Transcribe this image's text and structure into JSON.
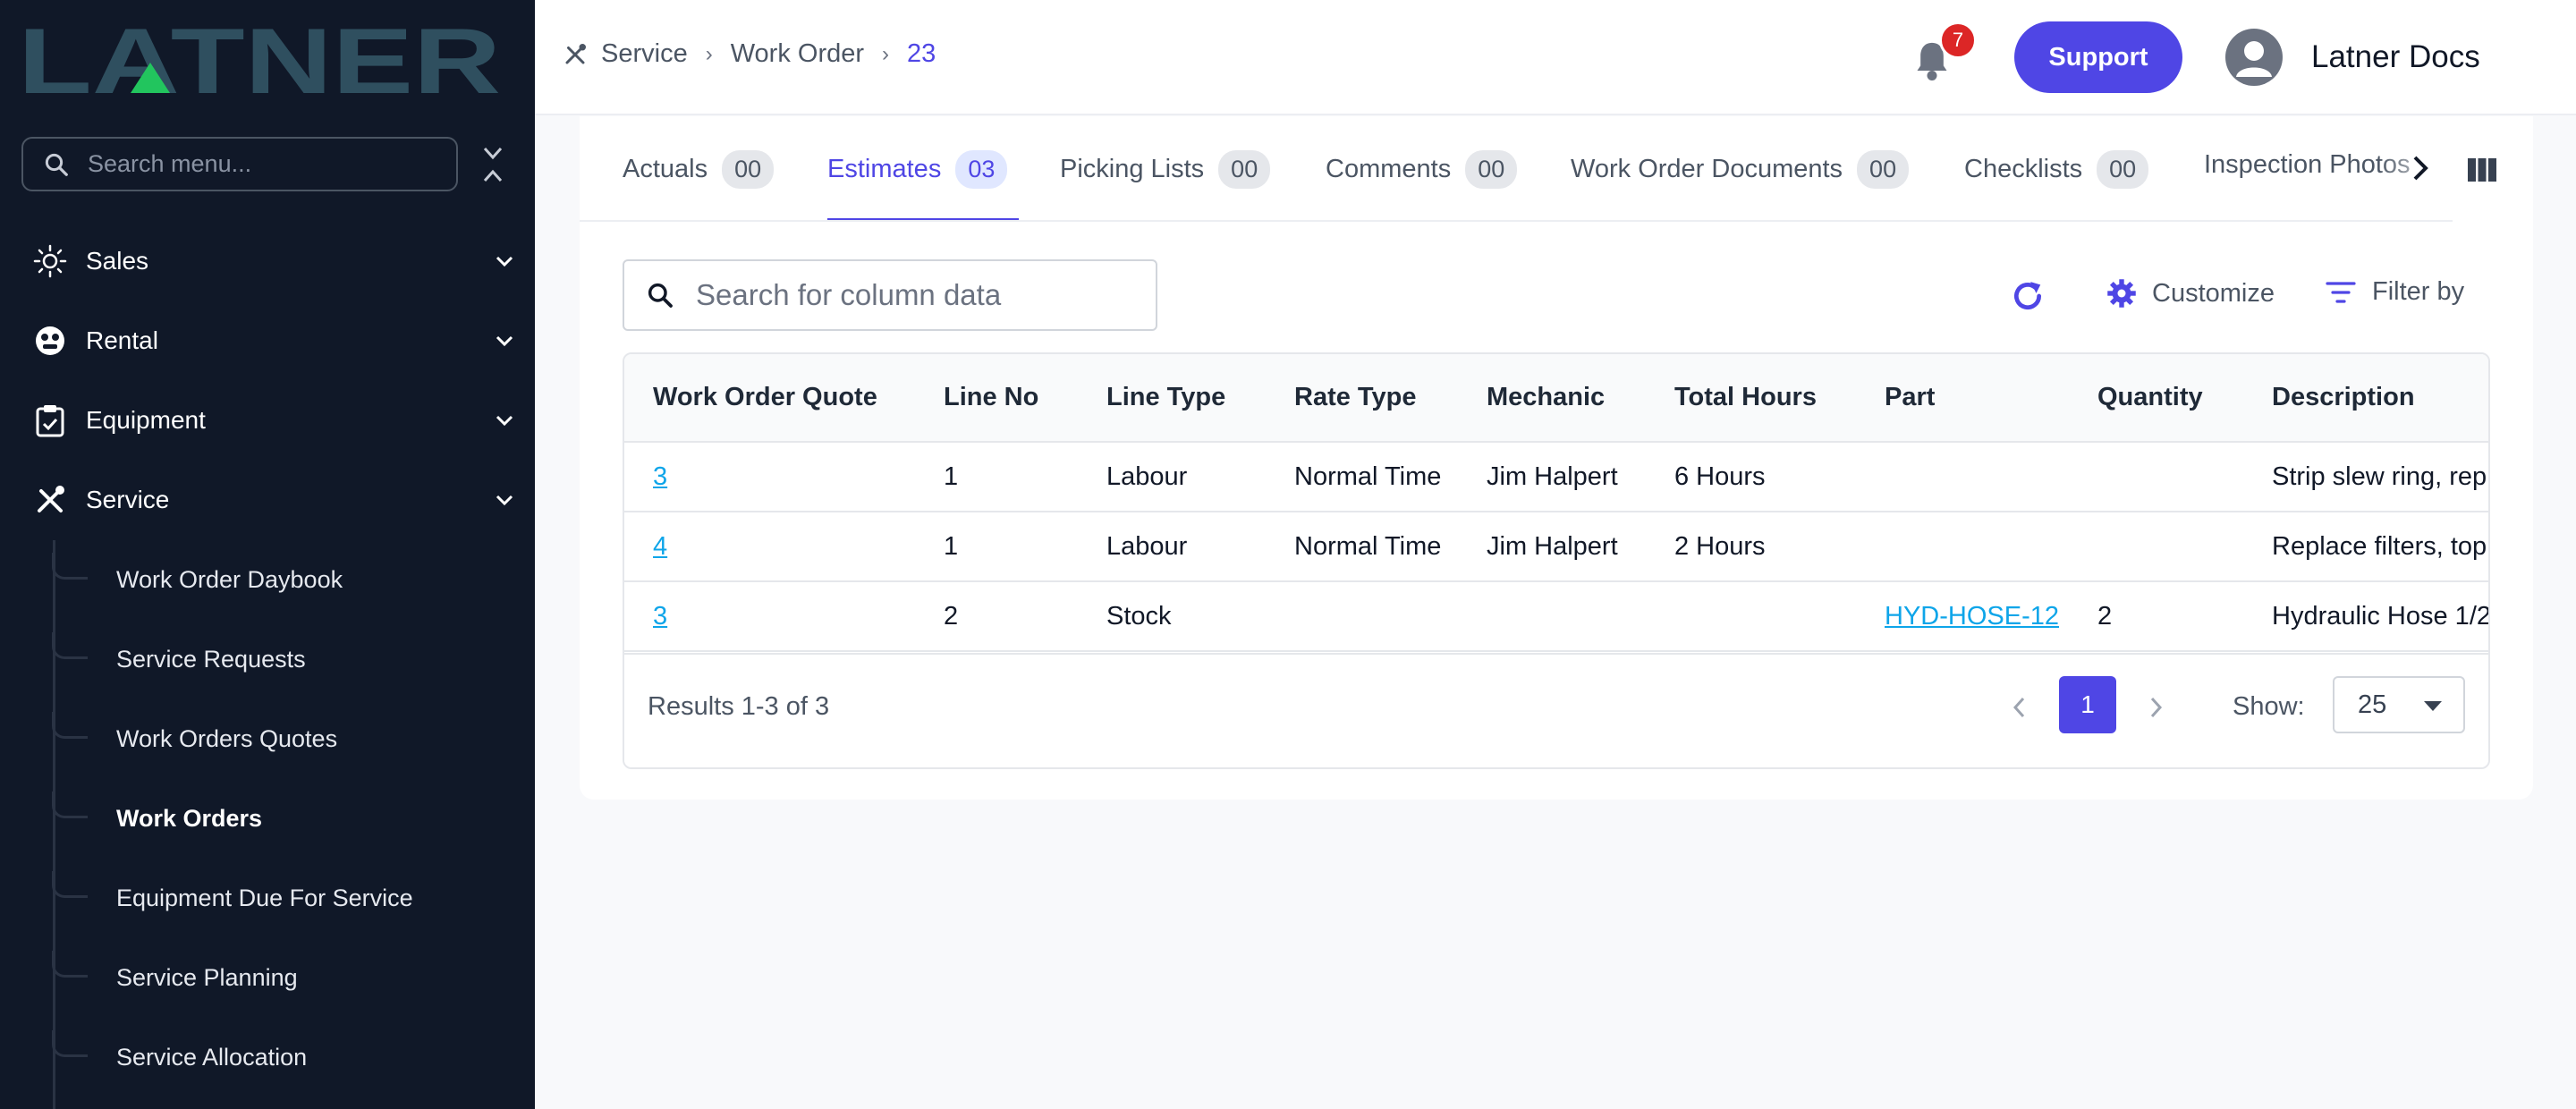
{
  "brand": {
    "logo_text": "LATNER"
  },
  "sidebar": {
    "search_placeholder": "Search menu...",
    "items": [
      {
        "label": "Sales",
        "icon": "sales-icon"
      },
      {
        "label": "Rental",
        "icon": "rental-icon"
      },
      {
        "label": "Equipment",
        "icon": "equipment-icon"
      },
      {
        "label": "Service",
        "icon": "service-tools-icon"
      }
    ],
    "service_subitems": [
      {
        "label": "Work Order Daybook"
      },
      {
        "label": "Service Requests"
      },
      {
        "label": "Work Orders Quotes"
      },
      {
        "label": "Work Orders",
        "active": true
      },
      {
        "label": "Equipment Due For Service"
      },
      {
        "label": "Service Planning"
      },
      {
        "label": "Service Allocation"
      }
    ]
  },
  "header": {
    "breadcrumb": [
      "Service",
      "Work Order",
      "23"
    ],
    "notification_count": "7",
    "support_label": "Support",
    "user_name": "Latner Docs"
  },
  "tabs": [
    {
      "label": "Actuals",
      "count": "00"
    },
    {
      "label": "Estimates",
      "count": "03",
      "active": true
    },
    {
      "label": "Picking Lists",
      "count": "00"
    },
    {
      "label": "Comments",
      "count": "00"
    },
    {
      "label": "Work Order Documents",
      "count": "00"
    },
    {
      "label": "Checklists",
      "count": "00"
    },
    {
      "label": "Inspection Photos",
      "count": ""
    }
  ],
  "toolbar": {
    "search_placeholder": "Search for column data",
    "customize_label": "Customize",
    "filter_label": "Filter by"
  },
  "table": {
    "columns": [
      "Work Order Quote",
      "Line No",
      "Line Type",
      "Rate Type",
      "Mechanic",
      "Total Hours",
      "Part",
      "Quantity",
      "Description"
    ],
    "rows": [
      {
        "quote": "3",
        "line_no": "1",
        "line_type": "Labour",
        "rate_type": "Normal Time",
        "mechanic": "Jim Halpert",
        "total_hours": "6 Hours",
        "part": "",
        "quantity": "",
        "description": "Strip slew ring, rep"
      },
      {
        "quote": "4",
        "line_no": "1",
        "line_type": "Labour",
        "rate_type": "Normal Time",
        "mechanic": "Jim Halpert",
        "total_hours": "2 Hours",
        "part": "",
        "quantity": "",
        "description": "Replace filters, top"
      },
      {
        "quote": "3",
        "line_no": "2",
        "line_type": "Stock",
        "rate_type": "",
        "mechanic": "",
        "total_hours": "",
        "part": "HYD-HOSE-12",
        "quantity": "2",
        "description": "Hydraulic Hose 1/2"
      }
    ]
  },
  "pagination": {
    "results_text": "Results 1-3 of 3",
    "current_page": "1",
    "show_label": "Show:",
    "page_size": "25"
  },
  "colors": {
    "accent": "#4f46e5",
    "sidebar_bg": "#101828",
    "link": "#0ea5e9",
    "badge": "#dc2626",
    "logo": "#2f4f5f",
    "logo_triangle": "#22c55e"
  }
}
